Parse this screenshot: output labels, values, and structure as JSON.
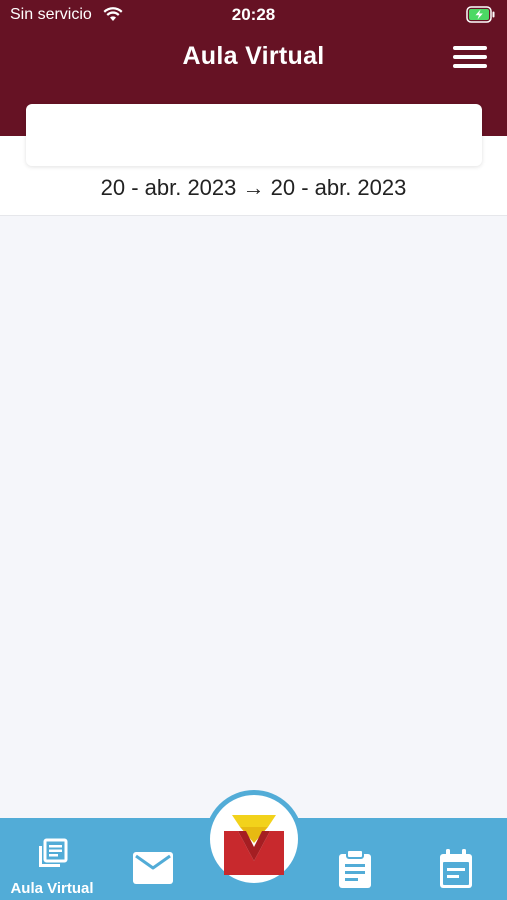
{
  "status_bar": {
    "carrier": "Sin servicio",
    "time": "20:28",
    "wifi_icon": "wifi-icon",
    "battery_icon": "battery-charging-icon"
  },
  "header": {
    "title": "Aula Virtual",
    "menu_icon": "hamburger-menu-icon",
    "background_color": "#661224"
  },
  "search": {
    "value": ""
  },
  "date_range": {
    "text": "20 - abr. 2023 → 20 - abr. 2023"
  },
  "bottom_nav": {
    "background_color": "#52acd7",
    "items": [
      {
        "label": "Aula Virtual",
        "icon": "library-books-icon"
      },
      {
        "label": "",
        "icon": "mail-icon"
      },
      {
        "label": "",
        "icon": "school-logo-icon"
      },
      {
        "label": "",
        "icon": "clipboard-icon"
      },
      {
        "label": "",
        "icon": "calendar-icon"
      }
    ]
  }
}
